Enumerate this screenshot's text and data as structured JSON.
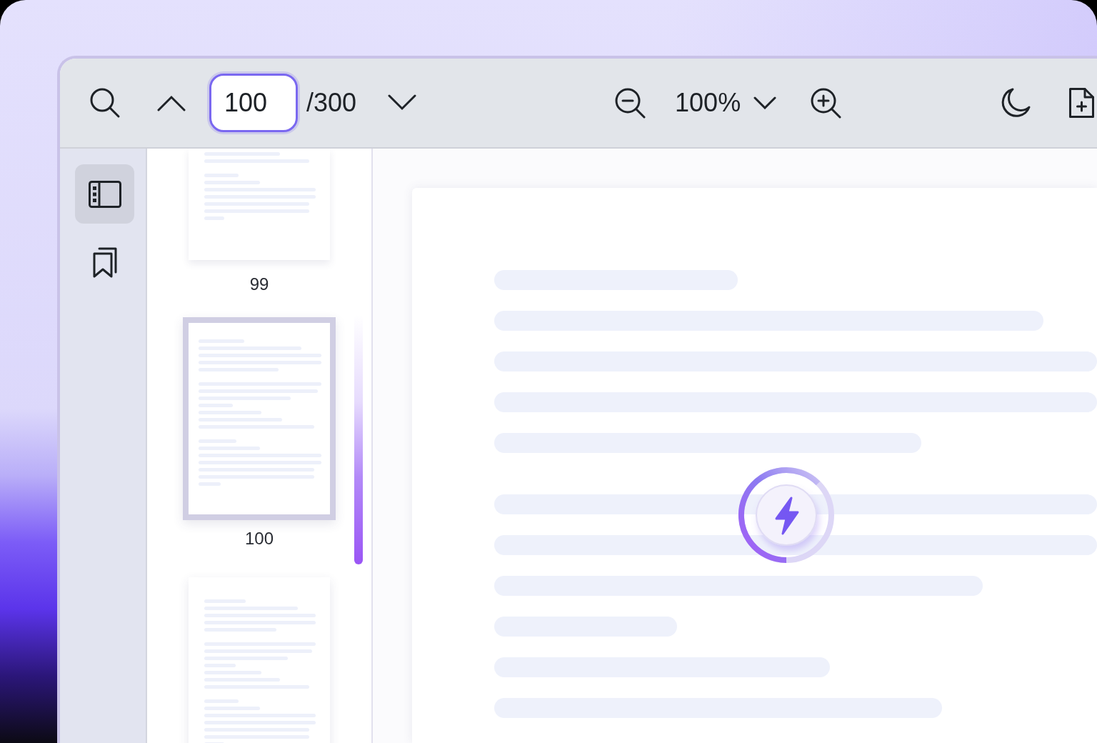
{
  "toolbar": {
    "page_field": {
      "value": "100",
      "focused": true
    },
    "page_total": "/300",
    "zoom": "100%"
  },
  "sidebar": {
    "items": [
      {
        "kind": "thumbnails",
        "selected": true
      },
      {
        "kind": "bookmarks",
        "selected": false
      }
    ]
  },
  "thumbnails": [
    {
      "label": "99",
      "selected": false
    },
    {
      "label": "100",
      "selected": true
    },
    {
      "selected": false
    }
  ],
  "viewer": {
    "loading": true
  }
}
